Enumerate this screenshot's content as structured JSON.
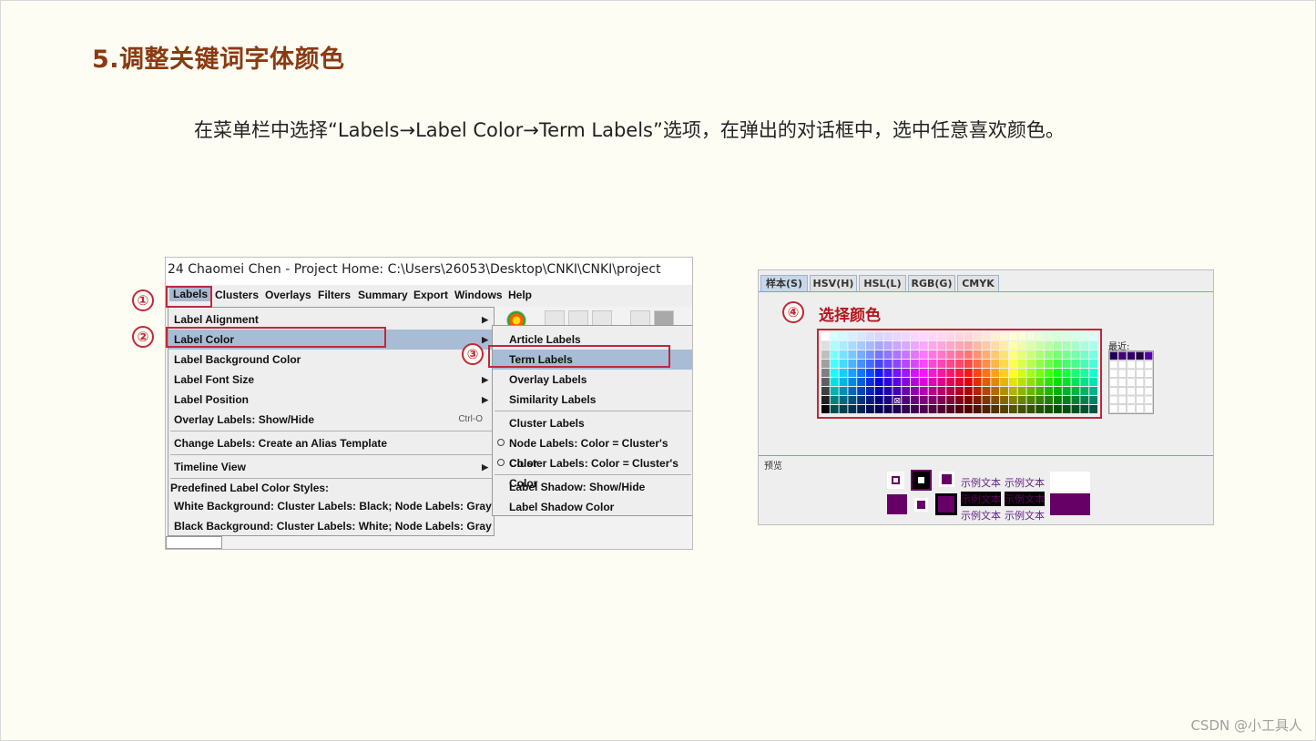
{
  "slide": {
    "title": "5.调整关键词字体颜色",
    "intro": "在菜单栏中选择“Labels→Label Color→Term Labels”选项，在弹出的对话框中，选中任意喜欢颜色。",
    "watermark": "CSDN @小工具人"
  },
  "markers": [
    "①",
    "②",
    "③",
    "④"
  ],
  "left_screenshot": {
    "window_title": "24 Chaomei Chen - Project Home: C:\\Users\\26053\\Desktop\\CNKI\\CNKI\\project",
    "menubar": [
      "Labels",
      "Clusters",
      "Overlays",
      "Filters",
      "Summary",
      "Export",
      "Windows",
      "Help"
    ],
    "dropdown": {
      "items": [
        {
          "label": "Label Alignment",
          "arrow": "▶"
        },
        {
          "label": "Label Color",
          "arrow": "▶"
        },
        {
          "label": "Label Background Color"
        },
        {
          "label": "Label Font Size",
          "arrow": "▶"
        },
        {
          "label": "Label Position",
          "arrow": "▶"
        },
        {
          "label": "Overlay Labels: Show/Hide",
          "shortcut": "Ctrl-O"
        },
        {
          "label": "Change Labels: Create an Alias Template"
        },
        {
          "label": "Timeline View",
          "arrow": "▶"
        },
        {
          "label": "White Background: Cluster Labels: Black; Node Labels: Gray"
        },
        {
          "label": "Black Background: Cluster Labels: White; Node Labels: Gray"
        }
      ],
      "section_header": "Predefined Label Color Styles:"
    },
    "submenu": {
      "items": [
        {
          "label": "Article Labels"
        },
        {
          "label": "Term Labels"
        },
        {
          "label": "Overlay Labels"
        },
        {
          "label": "Similarity Labels"
        },
        {
          "label": "Cluster Labels"
        },
        {
          "label": "Node Labels: Color = Cluster's Color",
          "radio": true
        },
        {
          "label": "Cluster Labels: Color = Cluster's Color",
          "radio": true
        },
        {
          "label": "Label Shadow: Show/Hide"
        },
        {
          "label": "Label Shadow Color"
        }
      ]
    }
  },
  "right_screenshot": {
    "tabs": [
      "样本(S)",
      "HSV(H)",
      "HSL(L)",
      "RGB(G)",
      "CMYK"
    ],
    "active_tab": "样本(S)",
    "pick_label": "选择颜色",
    "recent_label": "最近:",
    "preview_label": "预览",
    "sample_text": "示例文本",
    "selected_color": "#660066"
  }
}
